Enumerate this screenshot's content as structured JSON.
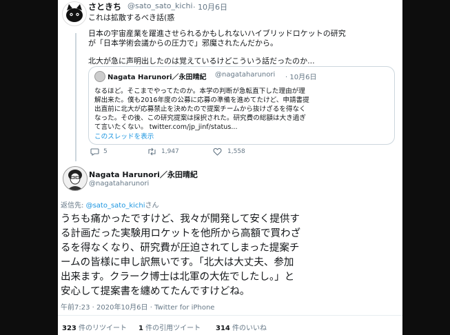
{
  "reply_tweet": {
    "display_name": "さときち",
    "handle": "@sato_sato_kichi",
    "date": "· 10月6日",
    "headline": "これは拡散するべき話(惑",
    "body_lines": [
      "日本の宇宙産業を躍進させられるかもしれないハイブリッドロケットの研究",
      "が「日本学術会議からの圧力で」邪魔されたんだから。",
      "",
      "北大が急に声明出したのは覚えているけどこういう話だったのか..."
    ],
    "stats": {
      "replies": "5",
      "retweets": "1,947",
      "likes": "1,558"
    }
  },
  "quoted_tweet": {
    "display_name": "Nagata Harunori／永田晴紀",
    "handle": "@nagataharunori",
    "date": "· 10月6日",
    "body_lines": [
      "なるほど。そこまでやってたのか。本学の判断が急転直下した理由が理",
      "解出来た。僕も2016年度の公募に応募の準備を進めてたけど、申請書提",
      "出直前に北大が応募禁止を決めたので提案チームから抜けざるを得なく",
      "なった。その後、この研究提案は採択された。研究費の総額は大き過ぎ",
      "て言いたくない。 twitter.com/jp_jinf/status..."
    ],
    "thread_link": "このスレッドを表示"
  },
  "main_tweet": {
    "display_name": "Nagata Harunori／永田晴紀",
    "handle": "@nagataharunori",
    "reply_prefix": "返信先: ",
    "reply_handle": "@sato_sato_kichi",
    "reply_suffix": "さん",
    "body_lines": [
      "うちも痛かったですけど、我々が開発して安く提供す",
      "る計画だった実験用ロケットを他所から高額で買わざ",
      "るを得なくなり、研究費が圧迫されてしまった提案チ",
      "ームの皆様に申し訳無いです。「北大は大丈夫、参加",
      "出来ます。クラーク博士は北軍の大佐でしたし。」と",
      "安心して提案書を纏めてたんですけどね。"
    ],
    "meta": "午前7:23 · 2020年10月6日 · Twitter for iPhone",
    "counts": [
      {
        "num": "323",
        "label": " 件のリツイート"
      },
      {
        "num": "1",
        "label": " 件の引用ツイート"
      },
      {
        "num": "314",
        "label": " 件のいいね"
      }
    ]
  },
  "icons": [
    "reply-icon",
    "retweet-icon",
    "heart-icon"
  ],
  "colors": {
    "background": "#0d0d0d",
    "card": "#ffffff",
    "link": "#1b95e0",
    "secondary": "#657786",
    "text": "#14171a"
  }
}
